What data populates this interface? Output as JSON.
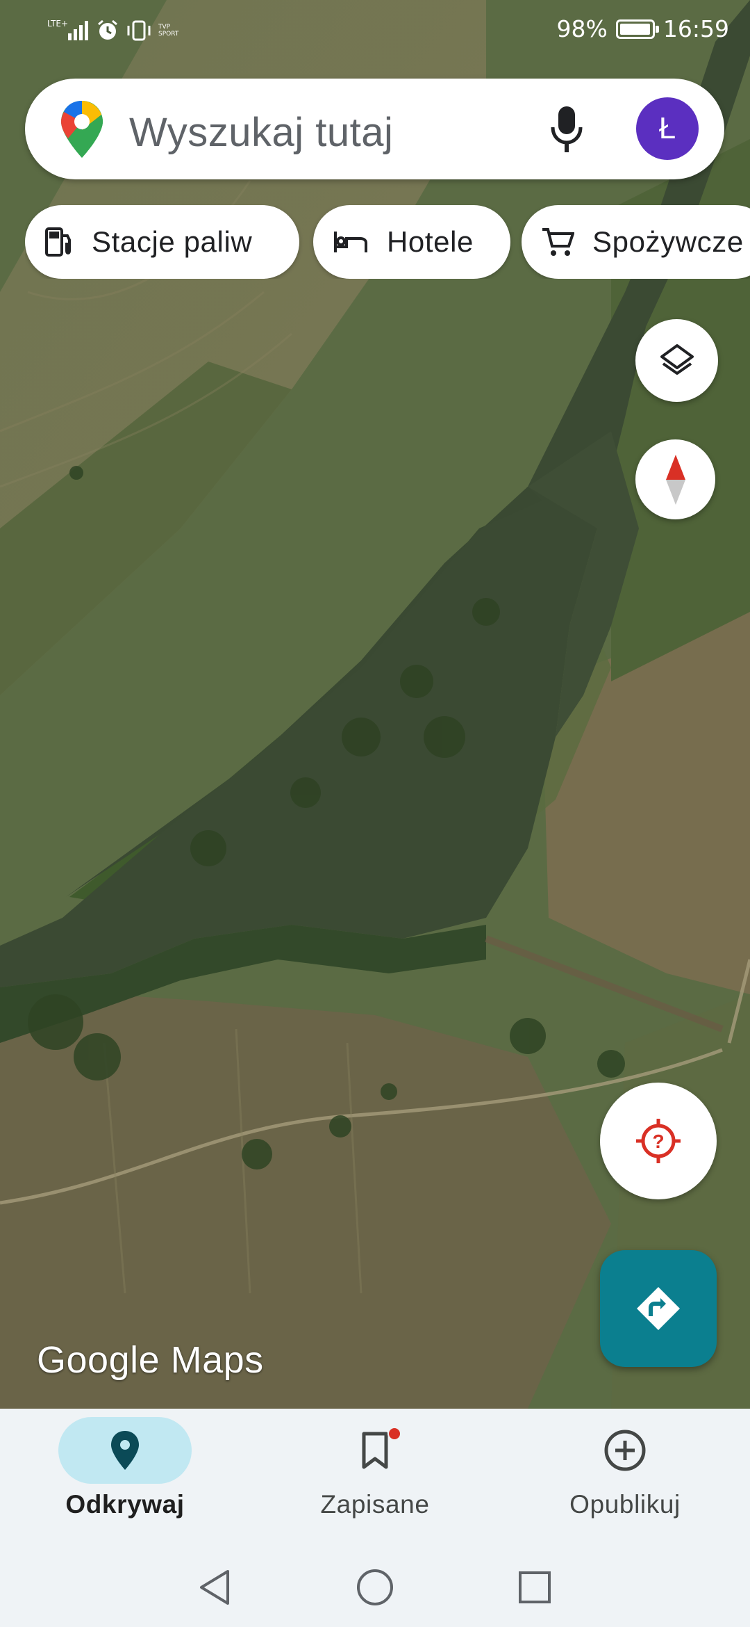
{
  "status_bar": {
    "network": "LTE+",
    "extra_badge": "TVP SPORT",
    "battery": "98%",
    "battery_level": 0.98,
    "time": "16:59"
  },
  "search": {
    "placeholder": "Wyszukaj tutaj",
    "avatar_letter": "Ł",
    "avatar_color": "#5b2fc0"
  },
  "chips": [
    {
      "label": "Stacje paliw",
      "icon": "gas-station-icon"
    },
    {
      "label": "Hotele",
      "icon": "bed-icon"
    },
    {
      "label": "Spożywcze",
      "icon": "shopping-cart-icon"
    }
  ],
  "map": {
    "brand": "Google Maps",
    "view": "satellite"
  },
  "fab": {
    "directions_color": "#0b7f8f",
    "location_icon_color": "#d93025"
  },
  "bottom_nav": {
    "items": [
      {
        "label": "Odkrywaj",
        "icon": "explore-pin-icon",
        "active": true
      },
      {
        "label": "Zapisane",
        "icon": "bookmark-icon",
        "active": false,
        "badge": true
      },
      {
        "label": "Opublikuj",
        "icon": "add-circle-icon",
        "active": false
      }
    ]
  }
}
